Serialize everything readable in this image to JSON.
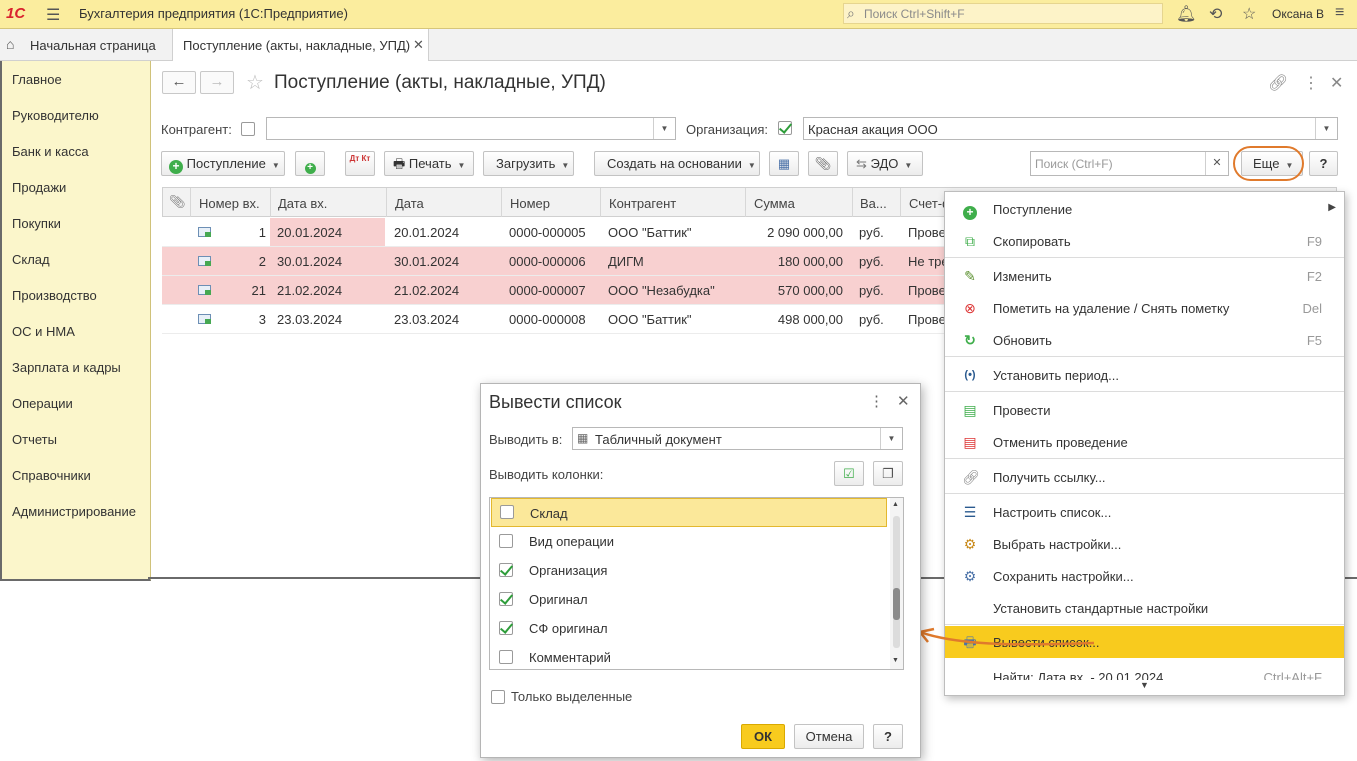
{
  "topbar": {
    "logo": "1С",
    "app_title": "Бухгалтерия предприятия  (1С:Предприятие)",
    "search_placeholder": "Поиск Ctrl+Shift+F",
    "user": "Оксана В"
  },
  "tabs": {
    "home": "Начальная страница",
    "document": "Поступление (акты, накладные, УПД)"
  },
  "sidebar": {
    "items": [
      "Главное",
      "Руководителю",
      "Банк и касса",
      "Продажи",
      "Покупки",
      "Склад",
      "Производство",
      "ОС и НМА",
      "Зарплата и кадры",
      "Операции",
      "Отчеты",
      "Справочники",
      "Администрирование"
    ]
  },
  "form": {
    "title": "Поступление (акты, накладные, УПД)",
    "kontragent_label": "Контрагент:",
    "kontragent_value": "",
    "org_label": "Организация:",
    "org_value": "Красная акация ООО",
    "search_placeholder": "Поиск (Ctrl+F)"
  },
  "toolbar": {
    "postuplenie": "Поступление",
    "dtkt": "Дт Кт",
    "print": "Печать",
    "load": "Загрузить",
    "create_based": "Создать на основании",
    "edo": "ЭДО",
    "more": "Еще",
    "help": "?"
  },
  "table": {
    "columns": [
      "Номер вх.",
      "Дата вх.",
      "Дата",
      "Номер",
      "Контрагент",
      "Сумма",
      "Ва...",
      "Счет-ф..."
    ],
    "rows": [
      {
        "num_in": "1",
        "date_in": "20.01.2024",
        "date": "20.01.2024",
        "number": "0000-000005",
        "contractor": "ООО \"Баттик\"",
        "sum": "2 090 000,00",
        "cur": "руб.",
        "invoice": "Прове",
        "highlight": false
      },
      {
        "num_in": "2",
        "date_in": "30.01.2024",
        "date": "30.01.2024",
        "number": "0000-000006",
        "contractor": "ДИГМ",
        "sum": "180 000,00",
        "cur": "руб.",
        "invoice": "Не тре",
        "highlight": true
      },
      {
        "num_in": "21",
        "date_in": "21.02.2024",
        "date": "21.02.2024",
        "number": "0000-000007",
        "contractor": "ООО \"Незабудка\"",
        "sum": "570 000,00",
        "cur": "руб.",
        "invoice": "Прове",
        "highlight": true
      },
      {
        "num_in": "3",
        "date_in": "23.03.2024",
        "date": "23.03.2024",
        "number": "0000-000008",
        "contractor": "ООО \"Баттик\"",
        "sum": "498 000,00",
        "cur": "руб.",
        "invoice": "Прове",
        "highlight": false
      }
    ]
  },
  "menu": {
    "items": [
      {
        "label": "Поступление",
        "shortcut": "",
        "icon": "add-icon",
        "submenu": true
      },
      {
        "label": "Скопировать",
        "shortcut": "F9",
        "icon": "copy-icon"
      },
      {
        "label": "Изменить",
        "shortcut": "F2",
        "icon": "pencil-icon"
      },
      {
        "label": "Пометить на удаление / Снять пометку",
        "shortcut": "Del",
        "icon": "delete-mark-icon"
      },
      {
        "label": "Обновить",
        "shortcut": "F5",
        "icon": "refresh-icon"
      },
      {
        "label": "Установить период...",
        "shortcut": "",
        "icon": "period-icon"
      },
      {
        "label": "Провести",
        "shortcut": "",
        "icon": "post-icon"
      },
      {
        "label": "Отменить проведение",
        "shortcut": "",
        "icon": "unpost-icon"
      },
      {
        "label": "Получить ссылку...",
        "shortcut": "",
        "icon": "link-icon"
      },
      {
        "label": "Настроить список...",
        "shortcut": "",
        "icon": "list-settings-icon"
      },
      {
        "label": "Выбрать настройки...",
        "shortcut": "",
        "icon": "load-settings-icon"
      },
      {
        "label": "Сохранить настройки...",
        "shortcut": "",
        "icon": "save-settings-icon"
      },
      {
        "label": "Установить стандартные настройки",
        "shortcut": "",
        "icon": ""
      },
      {
        "label": "Вывести список...",
        "shortcut": "",
        "icon": "output-list-icon"
      },
      {
        "label": "Найти: Дата вх. - 20.01.2024",
        "shortcut": "Ctrl+Alt+F",
        "icon": ""
      }
    ]
  },
  "dialog": {
    "title": "Вывести список",
    "output_to_label": "Выводить в:",
    "output_to_value": "Табличный документ",
    "columns_label": "Выводить колонки:",
    "columns": [
      {
        "label": "Склад",
        "checked": false,
        "selected": true
      },
      {
        "label": "Вид операции",
        "checked": false
      },
      {
        "label": "Организация",
        "checked": true
      },
      {
        "label": "Оригинал",
        "checked": true
      },
      {
        "label": "СФ оригинал",
        "checked": true
      },
      {
        "label": "Комментарий",
        "checked": false
      }
    ],
    "only_selected": "Только выделенные",
    "ok": "ОК",
    "cancel": "Отмена",
    "help": "?"
  }
}
